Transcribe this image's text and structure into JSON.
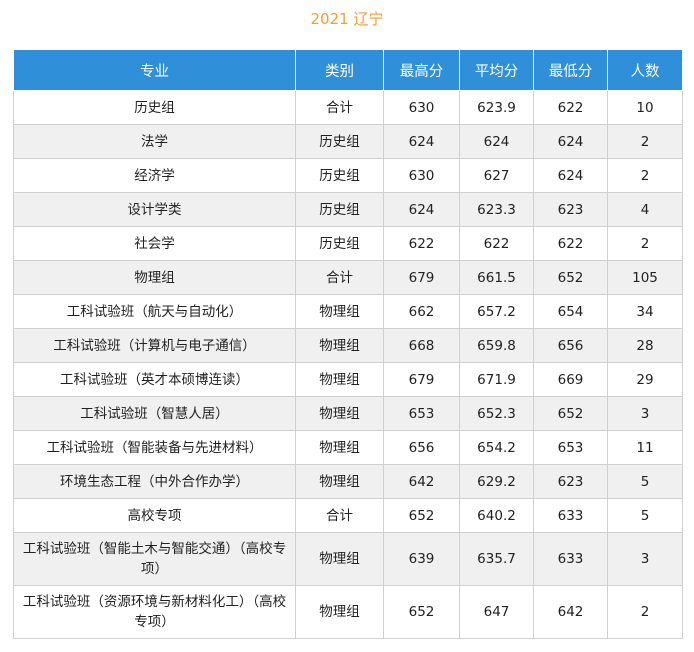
{
  "title": "2021 辽宁",
  "headers": [
    "专业",
    "类别",
    "最高分",
    "平均分",
    "最低分",
    "人数"
  ],
  "rows": [
    [
      "历史组",
      "合计",
      "630",
      "623.9",
      "622",
      "10"
    ],
    [
      "法学",
      "历史组",
      "624",
      "624",
      "624",
      "2"
    ],
    [
      "经济学",
      "历史组",
      "630",
      "627",
      "624",
      "2"
    ],
    [
      "设计学类",
      "历史组",
      "624",
      "623.3",
      "623",
      "4"
    ],
    [
      "社会学",
      "历史组",
      "622",
      "622",
      "622",
      "2"
    ],
    [
      "物理组",
      "合计",
      "679",
      "661.5",
      "652",
      "105"
    ],
    [
      "工科试验班（航天与自动化）",
      "物理组",
      "662",
      "657.2",
      "654",
      "34"
    ],
    [
      "工科试验班（计算机与电子通信）",
      "物理组",
      "668",
      "659.8",
      "656",
      "28"
    ],
    [
      "工科试验班（英才本硕博连读）",
      "物理组",
      "679",
      "671.9",
      "669",
      "29"
    ],
    [
      "工科试验班（智慧人居）",
      "物理组",
      "653",
      "652.3",
      "652",
      "3"
    ],
    [
      "工科试验班（智能装备与先进材料）",
      "物理组",
      "656",
      "654.2",
      "653",
      "11"
    ],
    [
      "环境生态工程（中外合作办学）",
      "物理组",
      "642",
      "629.2",
      "623",
      "5"
    ],
    [
      "高校专项",
      "合计",
      "652",
      "640.2",
      "633",
      "5"
    ],
    [
      "工科试验班（智能土木与智能交通）（高校专项）",
      "物理组",
      "639",
      "635.7",
      "633",
      "3"
    ],
    [
      "工科试验班（资源环境与新材料化工）（高校专项）",
      "物理组",
      "652",
      "647",
      "642",
      "2"
    ]
  ]
}
